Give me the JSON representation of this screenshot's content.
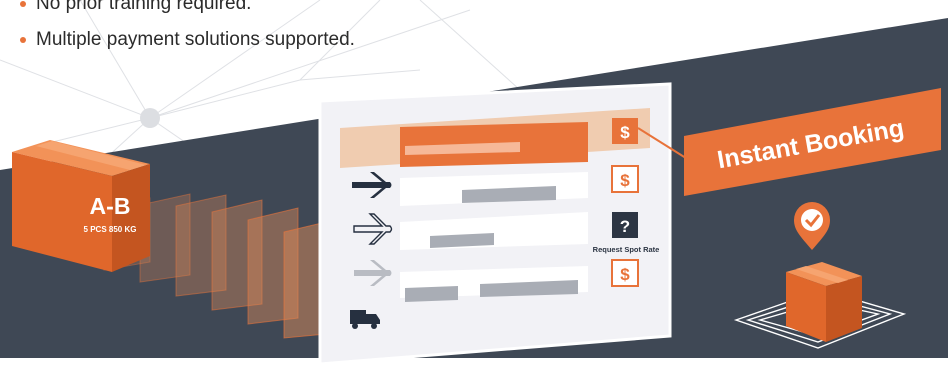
{
  "bullets": [
    {
      "text": "No prior training required."
    },
    {
      "text": "Multiple payment solutions supported."
    }
  ],
  "box": {
    "route": "A-B",
    "details": "5 PCS 850 KG"
  },
  "booking": {
    "label": "Instant Booking"
  },
  "rows": [
    {
      "mode_icon": "airplane-filled-icon",
      "price_icon": "dollar-icon",
      "price_text": "$"
    },
    {
      "mode_icon": "airplane-outline-icon",
      "price_icon": "dollar-icon",
      "price_text": "$"
    },
    {
      "mode_icon": "airplane-gray-icon",
      "price_icon": "question-icon",
      "price_text": "?",
      "note": "Request Spot Rate"
    },
    {
      "mode_icon": "truck-icon",
      "price_icon": "dollar-icon",
      "price_text": "$"
    }
  ],
  "colors": {
    "accent": "#e8733a",
    "dark": "#3f4855",
    "panel": "#f2f2f6",
    "bar": "#a9adb5"
  }
}
